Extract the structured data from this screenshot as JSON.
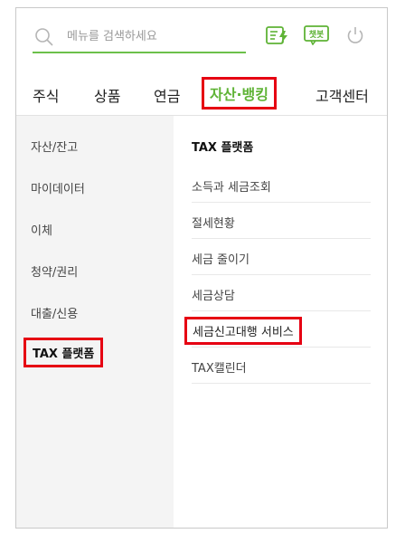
{
  "search": {
    "placeholder": "메뉴를 검색하세요"
  },
  "header_icons": [
    {
      "name": "memo-flash-icon"
    },
    {
      "name": "chatbot-icon",
      "label": "챗봇"
    },
    {
      "name": "power-icon"
    }
  ],
  "nav": {
    "tabs": [
      {
        "label": "주식"
      },
      {
        "label": "상품"
      },
      {
        "label": "연금"
      },
      {
        "label": "자산·뱅킹",
        "active": true
      },
      {
        "label": "고객센터"
      }
    ]
  },
  "sidebar": {
    "items": [
      {
        "label": "자산/잔고"
      },
      {
        "label": "마이데이터"
      },
      {
        "label": "이체"
      },
      {
        "label": "청약/권리"
      },
      {
        "label": "대출/신용"
      },
      {
        "label": "TAX 플랫폼",
        "active": true
      }
    ]
  },
  "submenu": {
    "heading": "TAX 플랫폼",
    "items": [
      {
        "label": "소득과 세금조회"
      },
      {
        "label": "절세현황"
      },
      {
        "label": "세금 줄이기"
      },
      {
        "label": "세금상담"
      },
      {
        "label": "세금신고대행 서비스",
        "active": true
      },
      {
        "label": "TAX캘린더"
      }
    ]
  },
  "colors": {
    "accent_green": "#5fb336",
    "highlight_red": "#e60012"
  }
}
